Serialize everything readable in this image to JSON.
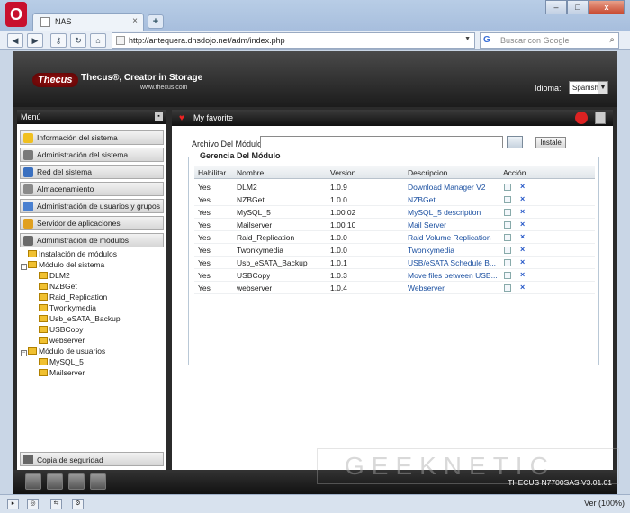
{
  "browser": {
    "tab_title": "NAS",
    "tab_close": "×",
    "new_tab": "+",
    "logo": "O",
    "address": "http://antequera.dnsdojo.net/adm/index.php",
    "search_placeholder": "Buscar con Google",
    "zoom": "Ver (100%)",
    "window_buttons": [
      "–",
      "□",
      "x"
    ]
  },
  "header": {
    "logo": "Thecus",
    "tagline": "Thecus®, Creator in Storage",
    "site": "www.thecus.com",
    "language_label": "Idioma:",
    "language_value": "Spanish"
  },
  "sidebar": {
    "title": "Menú",
    "items": [
      {
        "label": "Información del sistema",
        "color": "#f0c020"
      },
      {
        "label": "Administración del sistema",
        "color": "#7a7a7a"
      },
      {
        "label": "Red del sistema",
        "color": "#3a70c0"
      },
      {
        "label": "Almacenamiento",
        "color": "#8a8a8a"
      },
      {
        "label": "Administración de usuarios y grupos",
        "color": "#4a80d0"
      },
      {
        "label": "Servidor de aplicaciones",
        "color": "#e0a020"
      },
      {
        "label": "Administración de módulos",
        "color": "#6a6a6a"
      }
    ],
    "tree": {
      "install": "Instalación de módulos",
      "system_modules": "Módulo del sistema",
      "system_children": [
        "DLM2",
        "NZBGet",
        "Raid_Replication",
        "Twonkymedia",
        "Usb_eSATA_Backup",
        "USBCopy",
        "webserver"
      ],
      "user_modules": "Módulo de usuarios",
      "user_children": [
        "MySQL_5",
        "Mailserver"
      ]
    },
    "backup": "Copia de seguridad"
  },
  "main": {
    "favorite": "My favorite",
    "file_label": "Archivo Del Módulo:",
    "install_button": "Instale",
    "section_title": "Gerencia Del Módulo",
    "columns": [
      "Habilitar",
      "Nombre",
      "Version",
      "Descripcion",
      "Acción"
    ],
    "rows": [
      {
        "enabled": "Yes",
        "name": "DLM2",
        "version": "1.0.9",
        "description": "Download Manager V2"
      },
      {
        "enabled": "Yes",
        "name": "NZBGet",
        "version": "1.0.0",
        "description": "NZBGet"
      },
      {
        "enabled": "Yes",
        "name": "MySQL_5",
        "version": "1.00.02",
        "description": "MySQL_5 description"
      },
      {
        "enabled": "Yes",
        "name": "Mailserver",
        "version": "1.00.10",
        "description": "Mail Server"
      },
      {
        "enabled": "Yes",
        "name": "Raid_Replication",
        "version": "1.0.0",
        "description": "Raid Volume Replication"
      },
      {
        "enabled": "Yes",
        "name": "Twonkymedia",
        "version": "1.0.0",
        "description": "Twonkymedia"
      },
      {
        "enabled": "Yes",
        "name": "Usb_eSATA_Backup",
        "version": "1.0.1",
        "description": "USB/eSATA Schedule B..."
      },
      {
        "enabled": "Yes",
        "name": "USBCopy",
        "version": "1.0.3",
        "description": "Move files between USB..."
      },
      {
        "enabled": "Yes",
        "name": "webserver",
        "version": "1.0.4",
        "description": "Webserver"
      }
    ],
    "delete_glyph": "×"
  },
  "footer": {
    "model": "THECUS N7700SAS V3.01.01"
  },
  "watermark": "GEEKNETIC"
}
